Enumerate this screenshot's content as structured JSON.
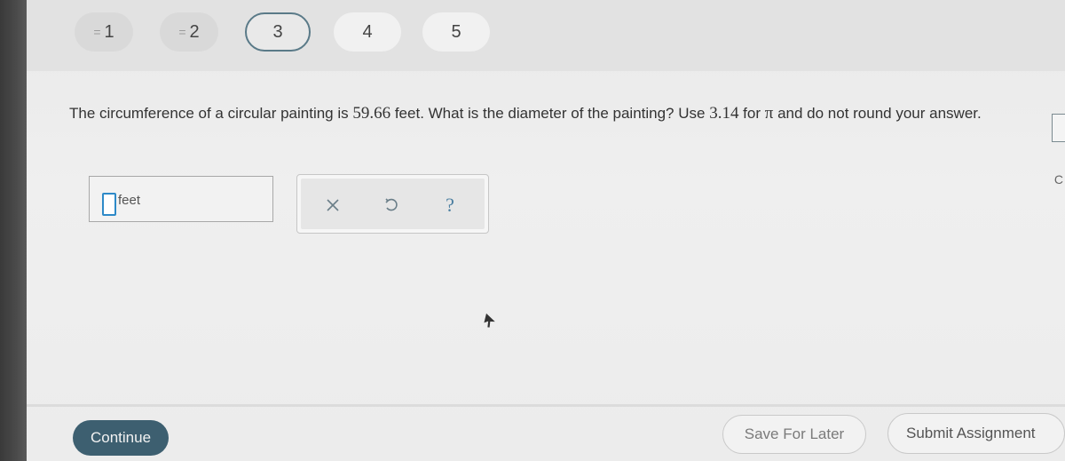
{
  "question_nav": [
    {
      "label": "1",
      "completed": true,
      "mark": "="
    },
    {
      "label": "2",
      "completed": true,
      "mark": "="
    },
    {
      "label": "3",
      "current": true
    },
    {
      "label": "4"
    },
    {
      "label": "5"
    }
  ],
  "question": {
    "part1": "The circumference of a circular painting is ",
    "circumference": "59.66",
    "part2": " feet. What is the diameter of the painting? Use ",
    "pi_value": "3.14",
    "part3": " for ",
    "pi_symbol": "π",
    "part4": " and do not round your answer."
  },
  "answer": {
    "value": "",
    "unit": "feet"
  },
  "tools": {
    "clear_icon": "x-icon",
    "undo_icon": "undo-icon",
    "help_label": "?"
  },
  "footer": {
    "continue_label": "Continue",
    "save_label": "Save For Later",
    "submit_label": "Submit Assignment"
  },
  "colors": {
    "accent": "#3d5f70",
    "input_focus": "#2e8ac8",
    "current_ring": "#5a7a88"
  }
}
